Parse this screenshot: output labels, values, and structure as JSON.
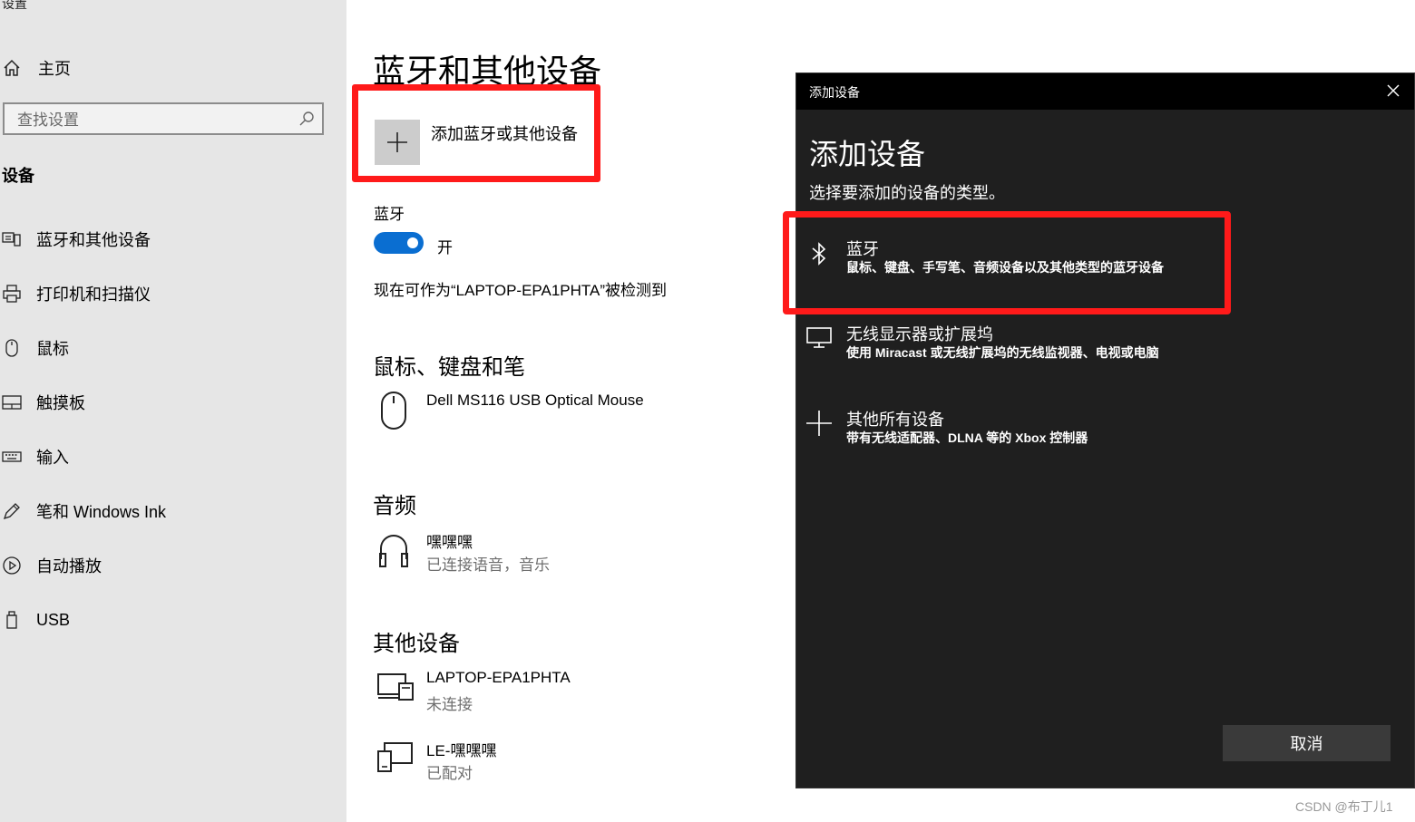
{
  "app": {
    "title": "设置"
  },
  "sidebar": {
    "home_label": "主页",
    "search_placeholder": "查找设置",
    "section_title": "设备",
    "items": [
      {
        "label": "蓝牙和其他设备",
        "icon": "bluetooth-devices-icon"
      },
      {
        "label": "打印机和扫描仪",
        "icon": "printer-icon"
      },
      {
        "label": "鼠标",
        "icon": "mouse-icon"
      },
      {
        "label": "触摸板",
        "icon": "touchpad-icon"
      },
      {
        "label": "输入",
        "icon": "keyboard-icon"
      },
      {
        "label": "笔和 Windows Ink",
        "icon": "pen-icon"
      },
      {
        "label": "自动播放",
        "icon": "autoplay-icon"
      },
      {
        "label": "USB",
        "icon": "usb-icon"
      }
    ]
  },
  "main": {
    "title": "蓝牙和其他设备",
    "add_device_label": "添加蓝牙或其他设备",
    "bluetooth": {
      "label": "蓝牙",
      "state": "开",
      "on": true
    },
    "discoverable_text": "现在可作为“LAPTOP-EPA1PHTA”被检测到",
    "groups": {
      "mouse_keyboard": {
        "title": "鼠标、键盘和笔",
        "device": {
          "name": "Dell MS116 USB Optical Mouse"
        }
      },
      "audio": {
        "title": "音频",
        "device": {
          "name": "嘿嘿嘿",
          "status": "已连接语音，音乐"
        }
      },
      "other": {
        "title": "其他设备",
        "devices": [
          {
            "name": "LAPTOP-EPA1PHTA",
            "status": "未连接"
          },
          {
            "name": "LE-嘿嘿嘿",
            "status": "已配对"
          }
        ]
      }
    }
  },
  "dialog": {
    "titlebar": "添加设备",
    "heading": "添加设备",
    "subtitle": "选择要添加的设备的类型。",
    "options": [
      {
        "title": "蓝牙",
        "desc": "鼠标、键盘、手写笔、音频设备以及其他类型的蓝牙设备",
        "icon": "bluetooth-icon"
      },
      {
        "title": "无线显示器或扩展坞",
        "desc": "使用 Miracast 或无线扩展坞的无线监视器、电视或电脑",
        "icon": "monitor-icon"
      },
      {
        "title": "其他所有设备",
        "desc": "带有无线适配器、DLNA 等的 Xbox 控制器",
        "icon": "plus-icon"
      }
    ],
    "cancel_label": "取消"
  },
  "watermark": "CSDN @布丁儿1",
  "colors": {
    "accent": "#0a6ed1",
    "highlight": "#ff1a1a",
    "dialog_bg": "#1f1f1f",
    "sidebar_bg": "#e6e6e6"
  }
}
